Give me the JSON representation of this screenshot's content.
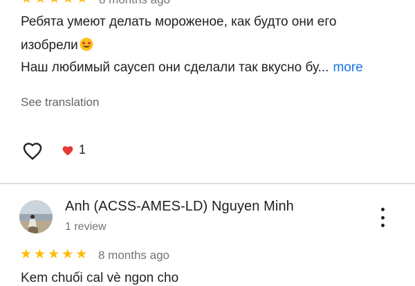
{
  "review_top": {
    "rating": 5,
    "time_ago": "8 months ago",
    "text_line1": "Ребята умеют делать мороженое, как будто они его",
    "text_line2": "изобрели",
    "text_line3": "Наш любимый саусеп они сделали так вкусно бу...",
    "more_label": "more",
    "see_translation": "See translation",
    "reaction_count": "1"
  },
  "review_second": {
    "author": "Anh (ACSS-AMES-LD) Nguyen Minh",
    "review_count": "1 review",
    "rating": 5,
    "time_ago": "8 months ago",
    "text_start": "Kem chuối cal vè ngon cho"
  },
  "colors": {
    "star": "#fbbc04",
    "link": "#1a73e8",
    "heart_red": "#e53935"
  },
  "icons": [
    "star-icon",
    "star-struck-emoji-icon",
    "heart-outline-icon",
    "heart-filled-icon",
    "more-vert-icon"
  ]
}
